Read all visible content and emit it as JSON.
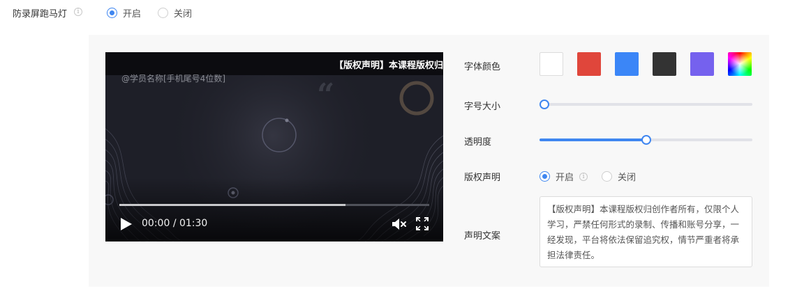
{
  "marquee": {
    "label": "防录屏跑马灯",
    "on_label": "开启",
    "off_label": "关闭",
    "selected": "on"
  },
  "video": {
    "banner_text": "【版权声明】本课程版权归",
    "watermark_text": "@学员名称[手机尾号4位数]",
    "current_time": "00:00",
    "separator": "/",
    "duration": "01:30",
    "progress_fraction": 0.73
  },
  "settings": {
    "font_color": {
      "label": "字体颜色",
      "swatches": [
        "#ffffff",
        "#e0463b",
        "#3b86f7",
        "#333333",
        "#7561ee",
        "rainbow"
      ]
    },
    "font_size": {
      "label": "字号大小",
      "value_fraction": 0.0
    },
    "opacity": {
      "label": "透明度",
      "value_fraction": 0.5
    },
    "copyright": {
      "label": "版权声明",
      "on_label": "开启",
      "off_label": "关闭",
      "selected": "on"
    },
    "copy_text": {
      "label": "声明文案",
      "value": "【版权声明】本课程版权归创作者所有，仅限个人学习，严禁任何形式的录制、传播和账号分享，一经发现，平台将依法保留追究权，情节严重者将承担法律责任。"
    }
  },
  "colors": {
    "accent": "#3f86f0",
    "panel_bg": "#f8f8f8"
  }
}
